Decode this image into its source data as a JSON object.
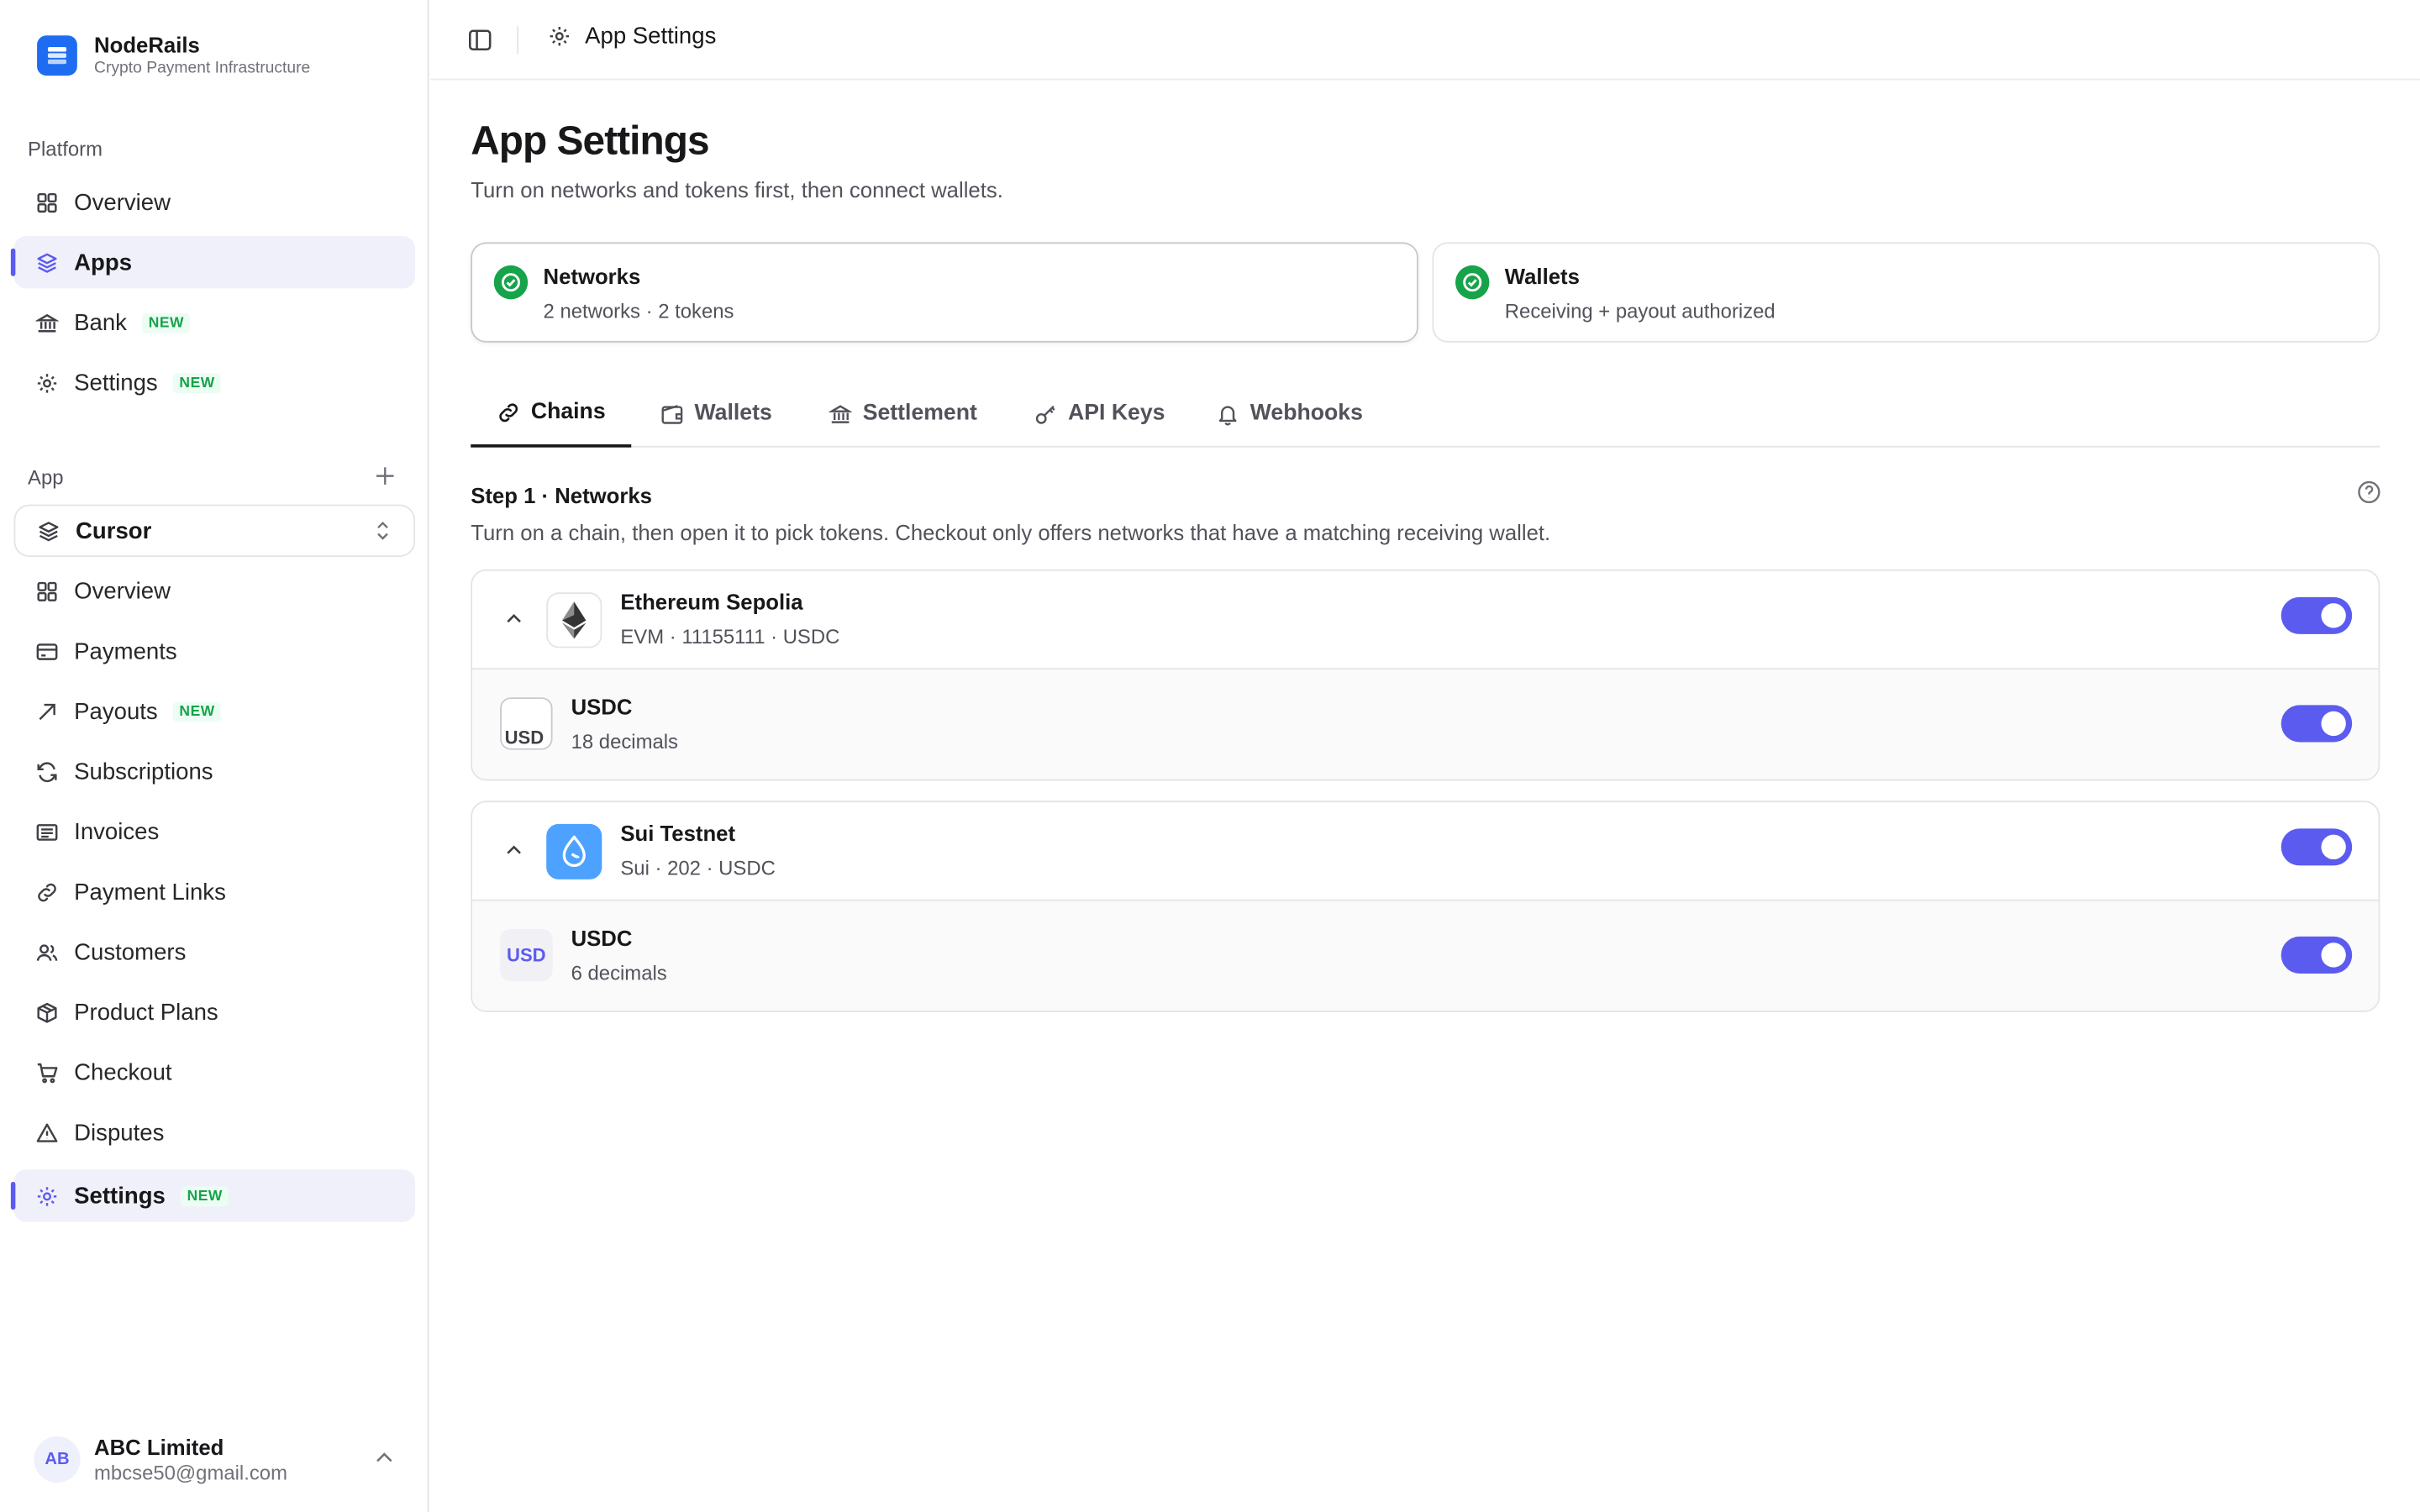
{
  "brand": {
    "name": "NodeRails",
    "subtitle": "Crypto Payment Infrastructure"
  },
  "sidebar": {
    "platform_label": "Platform",
    "platform_items": [
      {
        "label": "Overview",
        "icon": "grid-icon"
      },
      {
        "label": "Apps",
        "icon": "layers-icon",
        "active": true
      },
      {
        "label": "Bank",
        "icon": "bank-icon",
        "badge": "NEW"
      },
      {
        "label": "Settings",
        "icon": "gear-icon",
        "badge": "NEW"
      }
    ],
    "app_label": "App",
    "selected_app": "Cursor",
    "app_items": [
      {
        "label": "Overview",
        "icon": "grid-icon"
      },
      {
        "label": "Payments",
        "icon": "card-icon"
      },
      {
        "label": "Payouts",
        "icon": "arrow-up-right-icon",
        "badge": "NEW"
      },
      {
        "label": "Subscriptions",
        "icon": "refresh-icon"
      },
      {
        "label": "Invoices",
        "icon": "invoice-icon"
      },
      {
        "label": "Payment Links",
        "icon": "link-icon"
      },
      {
        "label": "Customers",
        "icon": "users-icon"
      },
      {
        "label": "Product Plans",
        "icon": "box-icon"
      },
      {
        "label": "Checkout",
        "icon": "cart-icon"
      },
      {
        "label": "Disputes",
        "icon": "warning-icon"
      },
      {
        "label": "Settings",
        "icon": "gear-icon",
        "badge": "NEW",
        "active": true
      }
    ],
    "account": {
      "initials": "AB",
      "name": "ABC Limited",
      "email": "mbcse50@gmail.com"
    }
  },
  "header": {
    "breadcrumb": "App Settings"
  },
  "page": {
    "title": "App Settings",
    "subtitle": "Turn on networks and tokens first, then connect wallets.",
    "steps": [
      {
        "title": "Networks",
        "desc": "2 networks · 2 tokens",
        "status": "complete"
      },
      {
        "title": "Wallets",
        "desc": "Receiving + payout authorized",
        "status": "complete"
      }
    ],
    "tabs": [
      {
        "label": "Chains",
        "icon": "link-icon",
        "active": true
      },
      {
        "label": "Wallets",
        "icon": "wallet-icon"
      },
      {
        "label": "Settlement",
        "icon": "bank-icon"
      },
      {
        "label": "API Keys",
        "icon": "key-icon"
      },
      {
        "label": "Webhooks",
        "icon": "bell-icon"
      }
    ],
    "section": {
      "title": "Step 1 · Networks",
      "subtitle": "Turn on a chain, then open it to pick tokens. Checkout only offers networks that have a matching receiving wallet."
    },
    "chains": [
      {
        "name": "Ethereum Sepolia",
        "meta": "EVM · 11155111 · USDC",
        "logo": "ethereum-icon",
        "enabled": true,
        "tokens": [
          {
            "name": "USDC",
            "decimals": "18 decimals",
            "logo_alt": "USD",
            "enabled": true
          }
        ]
      },
      {
        "name": "Sui Testnet",
        "meta": "Sui · 202 · USDC",
        "logo": "sui-icon",
        "enabled": true,
        "tokens": [
          {
            "name": "USDC",
            "decimals": "6 decimals",
            "logo_alt": "USD",
            "enabled": true
          }
        ]
      }
    ]
  },
  "colors": {
    "accent": "#5b5bf0",
    "success": "#16a34a",
    "brand": "#1d6cf2",
    "new_badge": "#16a34a"
  }
}
